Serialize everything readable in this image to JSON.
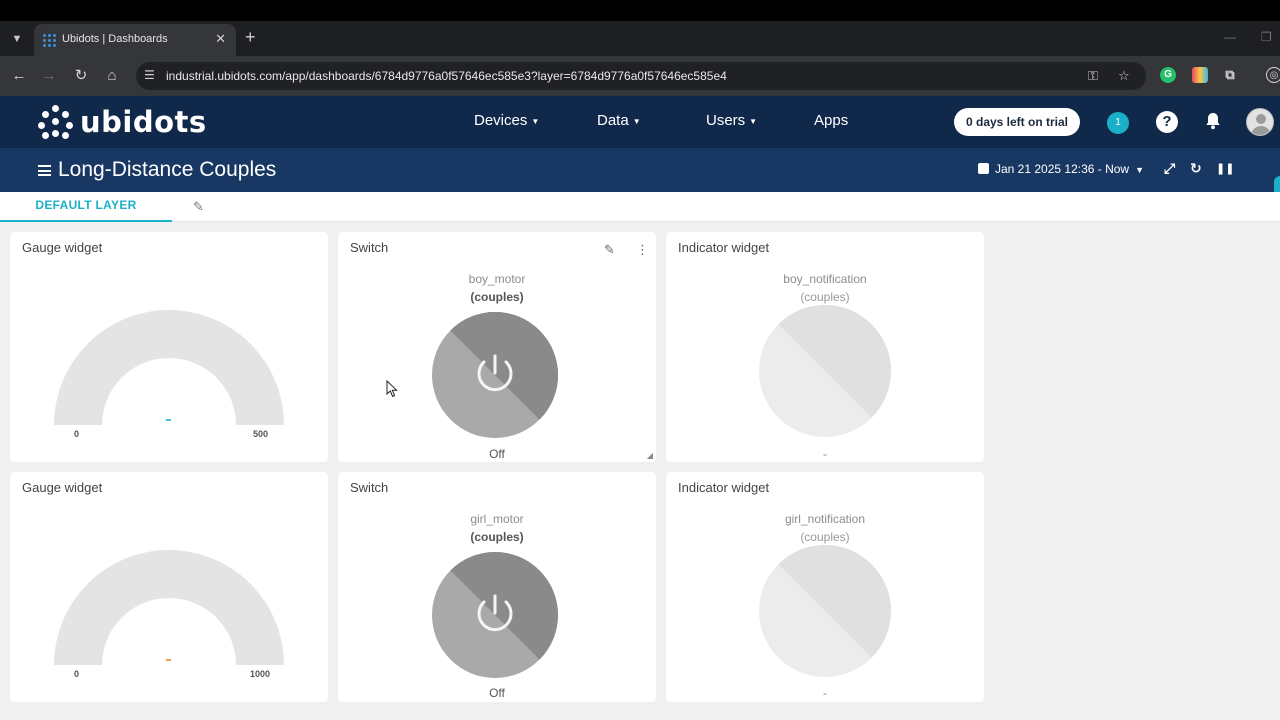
{
  "browser": {
    "tab_title": "Ubidots | Dashboards",
    "url": "industrial.ubidots.com/app/dashboards/6784d9776a0f57646ec585e3?layer=6784d9776a0f57646ec585e4"
  },
  "header": {
    "logo_text": "ubidots",
    "nav": {
      "devices": "Devices",
      "data": "Data",
      "users": "Users",
      "apps": "Apps"
    },
    "trial": "0 days left on trial",
    "notification_count": "1",
    "help": "?"
  },
  "dashboard": {
    "title": "Long-Distance Couples",
    "date_range": "Jan 21 2025 12:36 - Now",
    "layer": "DEFAULT LAYER"
  },
  "widgets": {
    "gauge1": {
      "title": "Gauge widget",
      "min": "0",
      "max": "500",
      "needle_color": "#3fc3d8"
    },
    "switch1": {
      "title": "Switch",
      "variable": "boy_motor",
      "device": "(couples)",
      "state": "Off"
    },
    "indicator1": {
      "title": "Indicator widget",
      "variable": "boy_notification",
      "device": "(couples)",
      "value": "-"
    },
    "gauge2": {
      "title": "Gauge widget",
      "min": "0",
      "max": "1000",
      "needle_color": "#f0a050"
    },
    "switch2": {
      "title": "Switch",
      "variable": "girl_motor",
      "device": "(couples)",
      "state": "Off"
    },
    "indicator2": {
      "title": "Indicator widget",
      "variable": "girl_notification",
      "device": "(couples)",
      "value": "-"
    }
  },
  "colors": {
    "header_bg": "#10294a",
    "dashboard_bar_bg": "#183863",
    "accent": "#1ab0c9"
  }
}
